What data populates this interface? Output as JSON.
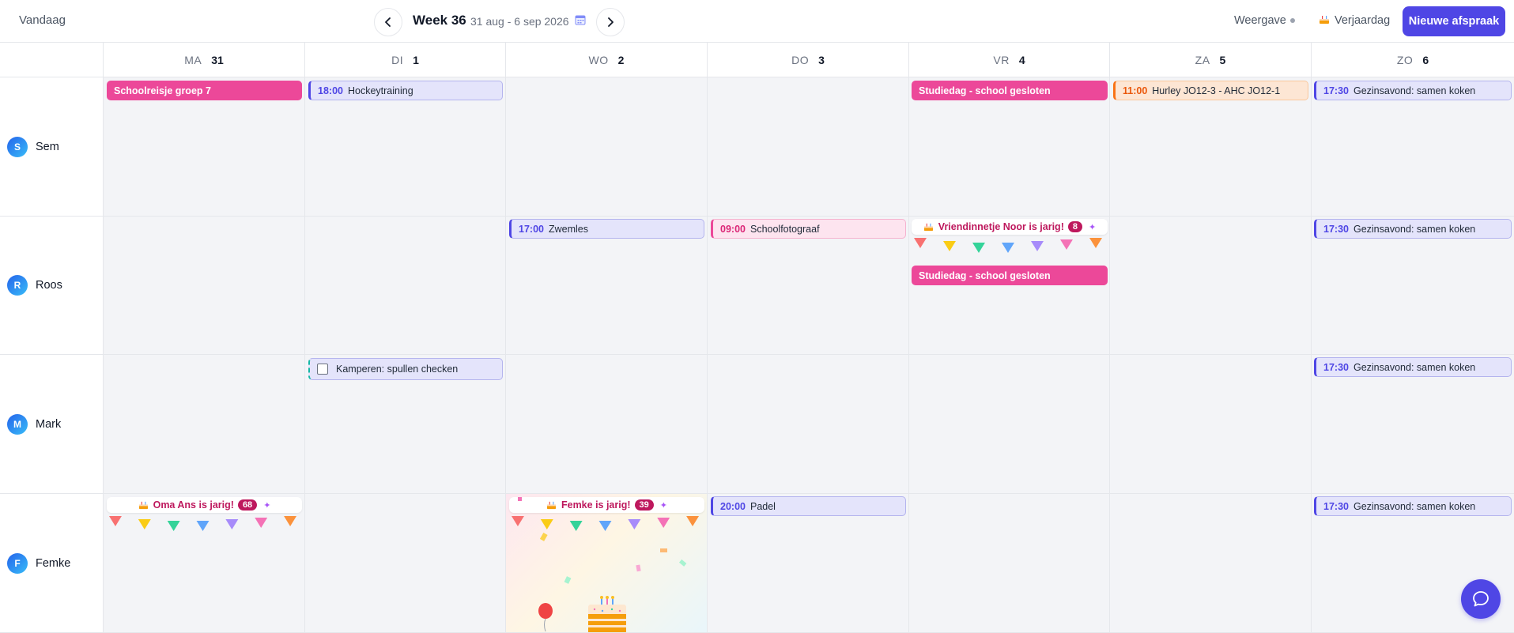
{
  "toolbar": {
    "today_label": "Vandaag",
    "week_title": "Week 36",
    "week_range": "31 aug - 6 sep 2026",
    "view_label": "Weergave",
    "birthday_label": "Verjaardag",
    "new_label": "Nieuwe afspraak"
  },
  "days": [
    {
      "dow": "MA",
      "num": "31"
    },
    {
      "dow": "DI",
      "num": "1"
    },
    {
      "dow": "WO",
      "num": "2"
    },
    {
      "dow": "DO",
      "num": "3"
    },
    {
      "dow": "VR",
      "num": "4"
    },
    {
      "dow": "ZA",
      "num": "5"
    },
    {
      "dow": "ZO",
      "num": "6"
    }
  ],
  "people": [
    {
      "initial": "S",
      "name": "Sem"
    },
    {
      "initial": "R",
      "name": "Roos"
    },
    {
      "initial": "M",
      "name": "Mark"
    },
    {
      "initial": "F",
      "name": "Femke"
    }
  ],
  "events": {
    "sem_ma": {
      "title": "Schoolreisje groep 7"
    },
    "sem_di": {
      "time": "18:00",
      "title": "Hockeytraining"
    },
    "sem_vr": {
      "title": "Studiedag - school gesloten"
    },
    "sem_za": {
      "time": "11:00",
      "title": "Hurley JO12-3 - AHC JO12-1"
    },
    "sem_zo": {
      "time": "17:30",
      "title": "Gezinsavond: samen koken"
    },
    "roos_wo": {
      "time": "17:00",
      "title": "Zwemles"
    },
    "roos_do": {
      "time": "09:00",
      "title": "Schoolfotograaf"
    },
    "roos_vr_bday": {
      "title": "Vriendinnetje Noor is jarig!",
      "age": "8"
    },
    "roos_vr": {
      "title": "Studiedag - school gesloten"
    },
    "roos_zo": {
      "time": "17:30",
      "title": "Gezinsavond: samen koken"
    },
    "mark_di": {
      "title": "Kamperen: spullen checken"
    },
    "mark_zo": {
      "time": "17:30",
      "title": "Gezinsavond: samen koken"
    },
    "femke_ma_bday": {
      "title": "Oma Ans is jarig!",
      "age": "68"
    },
    "femke_wo_bday": {
      "title": "Femke is jarig!",
      "age": "39"
    },
    "femke_do": {
      "time": "20:00",
      "title": "Padel"
    },
    "femke_zo": {
      "time": "17:30",
      "title": "Gezinsavond: samen koken"
    }
  },
  "colors": {
    "accent": "#4f46e5",
    "allday_pink": "#ec4899",
    "birthday_text": "#be185d",
    "orange": "#f97316"
  },
  "icons": [
    "chevron-left-icon",
    "chevron-right-icon",
    "calendar-icon",
    "cake-icon",
    "party-icon",
    "chat-icon",
    "balloon-icon"
  ]
}
